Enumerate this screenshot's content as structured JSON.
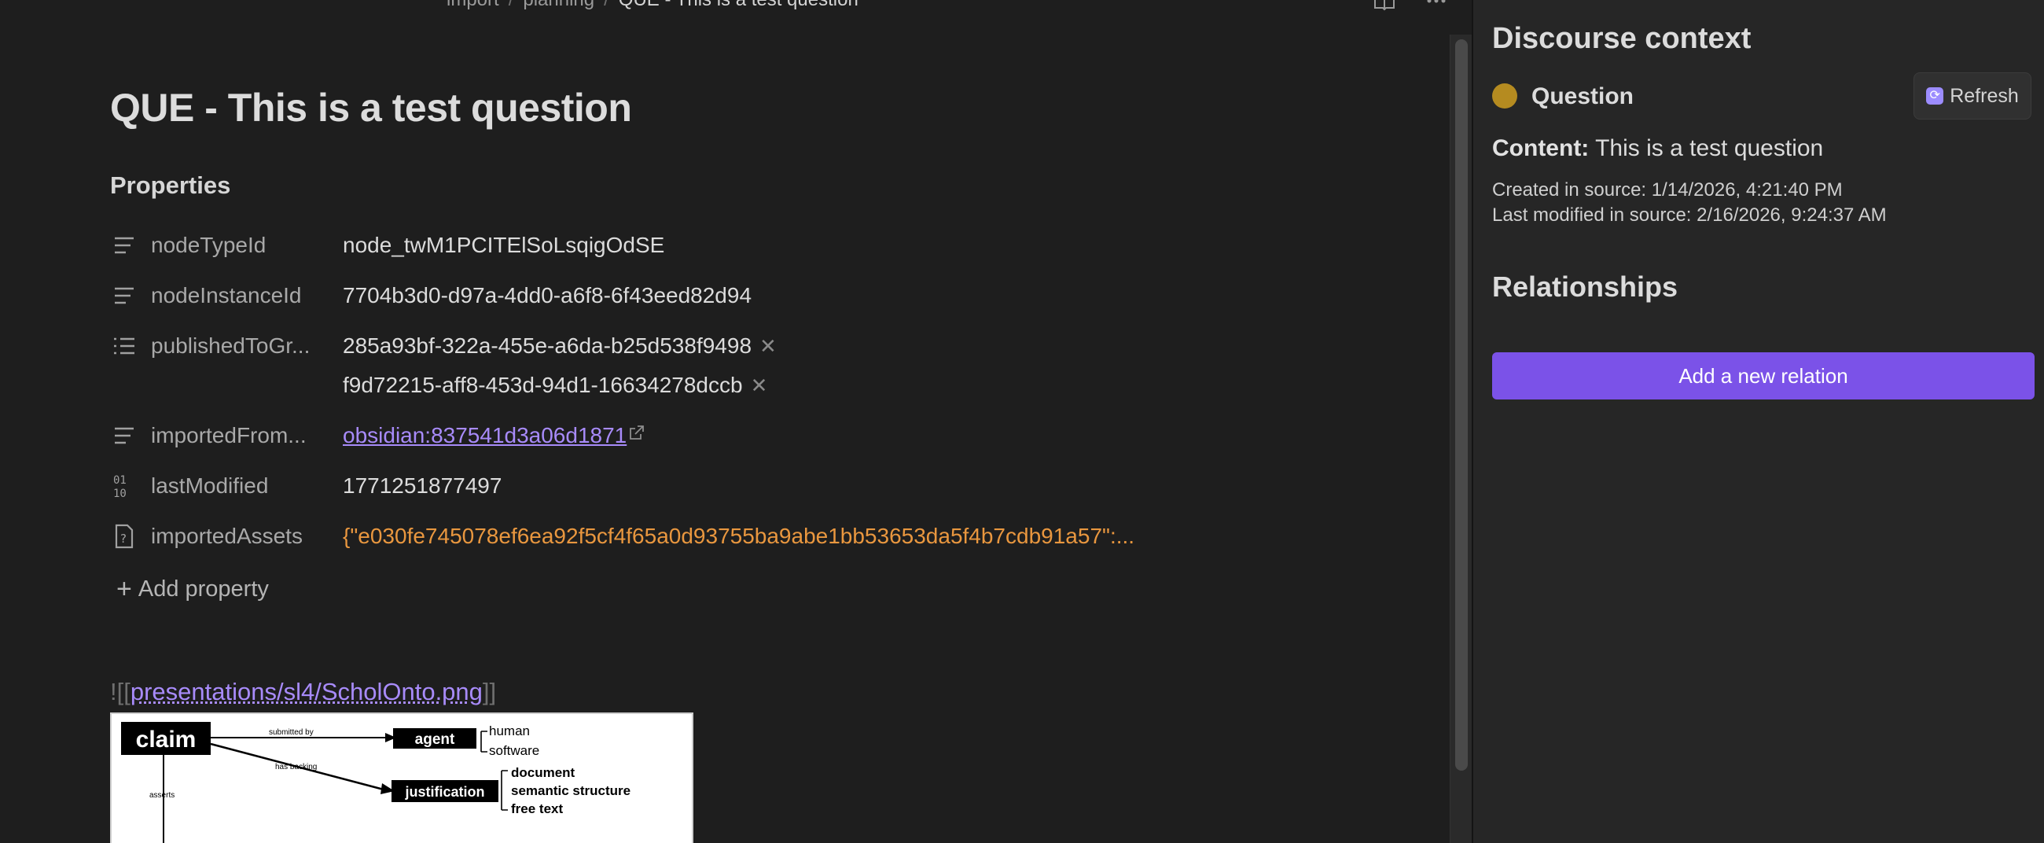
{
  "breadcrumb": {
    "items": [
      "import",
      "planning"
    ],
    "current": "QUE - This is a test question"
  },
  "header": {
    "icons": [
      "book-open-icon",
      "more-horizontal-icon"
    ]
  },
  "note": {
    "title": "QUE - This is a test question",
    "properties_heading": "Properties",
    "properties": [
      {
        "key": "nodeTypeId",
        "value": "node_twM1PCITElSoLsqigOdSE",
        "icon": "text-lines-icon"
      },
      {
        "key": "nodeInstanceId",
        "value": "7704b3d0-d97a-4dd0-a6f8-6f43eed82d94",
        "icon": "text-lines-icon"
      },
      {
        "key": "publishedToGr...",
        "values": [
          "285a93bf-322a-455e-a6da-b25d538f9498",
          "f9d72215-aff8-453d-94d1-16634278dccb"
        ],
        "icon": "list-icon"
      },
      {
        "key": "importedFrom...",
        "value": "obsidian:837541d3a06d1871",
        "icon": "text-lines-icon"
      },
      {
        "key": "lastModified",
        "value": "1771251877497",
        "icon": "number-icon"
      },
      {
        "key": "importedAssets",
        "value": "{\"e030fe745078ef6ea92f5cf4f65a0d93755ba9abe1bb53653da5f4b7cdb91a57\":...",
        "icon": "unknown-type-icon"
      }
    ],
    "add_property_label": "Add property",
    "embed": {
      "prefix": "![[",
      "link": "presentations/sl4/ScholOnto.png",
      "suffix": "]]"
    },
    "diagram": {
      "claim": "claim",
      "agent": "agent",
      "justification": "justification",
      "submitted_by": "submitted by",
      "has_backing": "has backing",
      "asserts": "asserts",
      "agent_types": [
        "human",
        "software"
      ],
      "justification_types": [
        "document",
        "semantic structure",
        "free text"
      ]
    }
  },
  "sidebar": {
    "title": "Discourse context",
    "node_type": "Question",
    "node_type_color": "#b58b20",
    "refresh_label": "Refresh",
    "content_label": "Content:",
    "content_value": "This is a test question",
    "created": "Created in source: 1/14/2026, 4:21:40 PM",
    "modified": "Last modified in source: 2/16/2026, 9:24:37 AM",
    "relationships_title": "Relationships",
    "add_relation_label": "Add a new relation"
  },
  "colors": {
    "accent": "#7b52e8",
    "link": "#a88bfa",
    "json": "#e9973f",
    "background": "#1e1e1e",
    "sidebar": "#262626"
  }
}
